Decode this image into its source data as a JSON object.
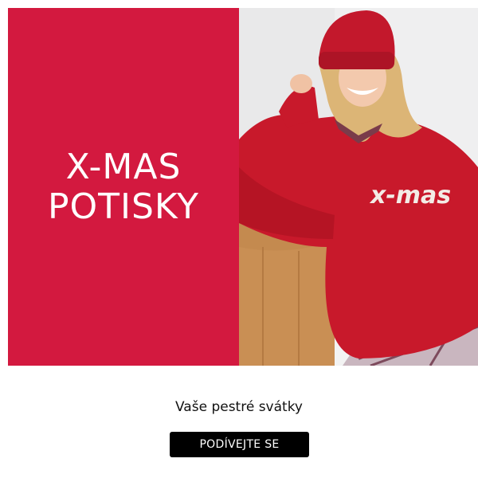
{
  "banner": {
    "headline_line1": "X-MAS",
    "headline_line2": "POTISKY",
    "accent_color": "#d3193f",
    "photo": {
      "description_icon": "woman-in-red-sweater-photo",
      "sweater_print": "x-mas"
    }
  },
  "tagline": "Vaše pestré svátky",
  "cta": {
    "label": "PODÍVEJTE SE",
    "background": "#000000"
  }
}
